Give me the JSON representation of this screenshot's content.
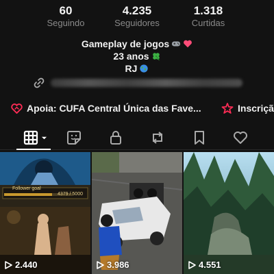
{
  "stats": [
    {
      "value": "60",
      "label": "Seguindo"
    },
    {
      "value": "4.235",
      "label": "Seguidores"
    },
    {
      "value": "1.318",
      "label": "Curtidas"
    }
  ],
  "bio": {
    "line1": "Gameplay de jogos",
    "line1_icons": [
      "gamepad-icon",
      "heart-icon"
    ],
    "line2": "23 anos",
    "line2_icon": "four-leaf-clover-icon",
    "line3": "RJ",
    "line3_icon": "globe-icon"
  },
  "link": {
    "icon": "link-icon"
  },
  "promo": [
    {
      "icon": "charity-heart-icon",
      "label": "Apoia: CUFA Central Única das Fave..."
    },
    {
      "icon": "subscription-icon",
      "label": "Inscriçã"
    }
  ],
  "tabs": [
    {
      "name": "videos",
      "icon": "grid-icon",
      "active": true
    },
    {
      "name": "stickers",
      "icon": "sticker-icon"
    },
    {
      "name": "private",
      "icon": "lock-icon"
    },
    {
      "name": "reposts",
      "icon": "repost-icon"
    },
    {
      "name": "favorites",
      "icon": "bookmark-icon"
    },
    {
      "name": "liked",
      "icon": "heart-outline-icon"
    }
  ],
  "videos": [
    {
      "views": "2.440",
      "thumb": "game-hud-scene",
      "hud_text": "Follower goal",
      "hud_count": "4379 / 5000"
    },
    {
      "views": "3.986",
      "thumb": "pickup-truck-scene"
    },
    {
      "views": "4.551",
      "thumb": "forest-scene"
    }
  ],
  "colors": {
    "background": "#121212",
    "muted_text": "#8a8a8a",
    "promo_red": "#fe2c55"
  }
}
